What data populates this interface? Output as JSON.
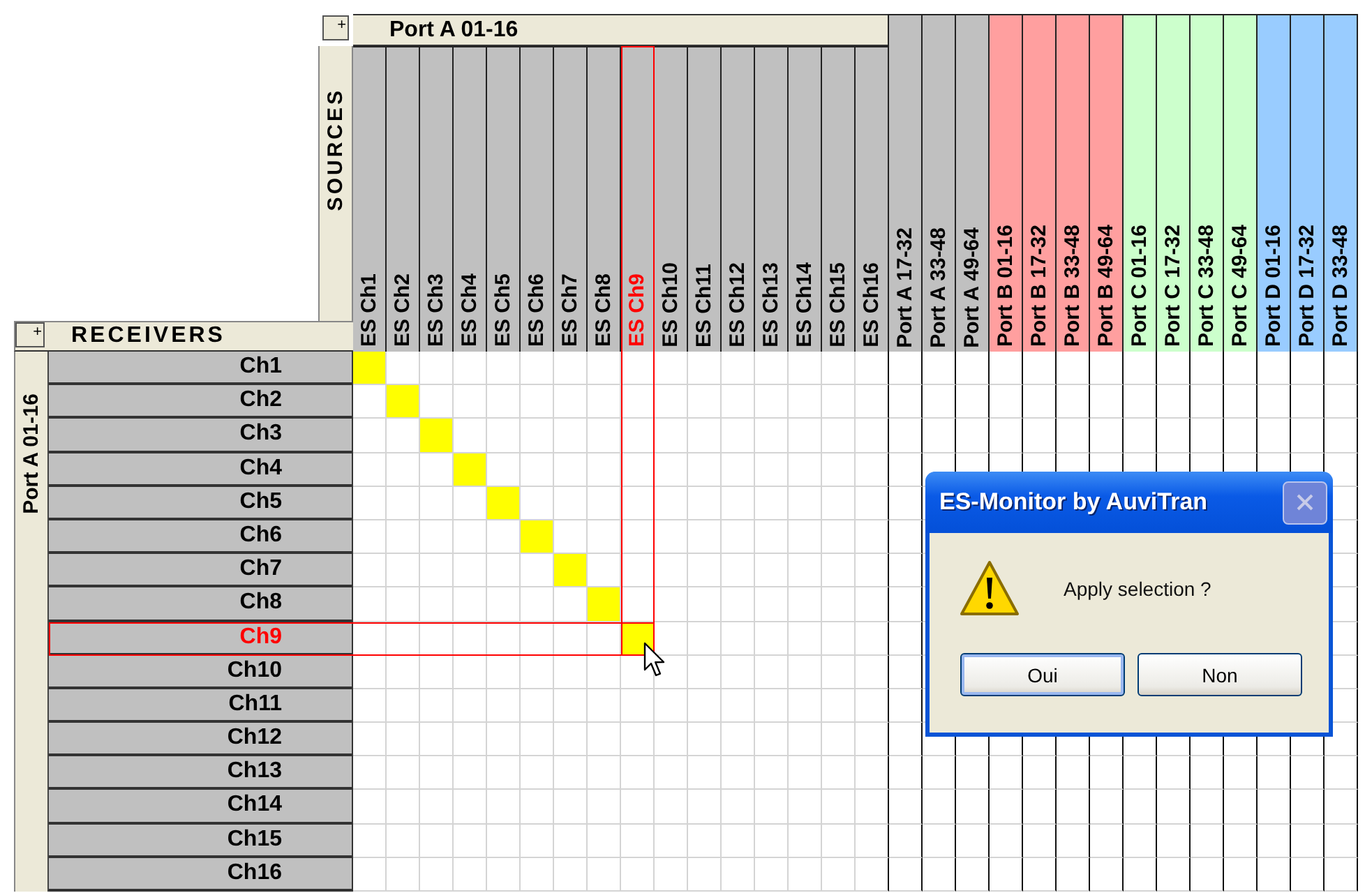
{
  "sources": {
    "expand": "+",
    "title": "SOURCES",
    "group_label": "Port A 01-16",
    "columns": [
      {
        "label": "ES Ch1",
        "kind": "channel",
        "color": "#c0c0c0",
        "selected": false
      },
      {
        "label": "ES Ch2",
        "kind": "channel",
        "color": "#c0c0c0",
        "selected": false
      },
      {
        "label": "ES Ch3",
        "kind": "channel",
        "color": "#c0c0c0",
        "selected": false
      },
      {
        "label": "ES Ch4",
        "kind": "channel",
        "color": "#c0c0c0",
        "selected": false
      },
      {
        "label": "ES Ch5",
        "kind": "channel",
        "color": "#c0c0c0",
        "selected": false
      },
      {
        "label": "ES Ch6",
        "kind": "channel",
        "color": "#c0c0c0",
        "selected": false
      },
      {
        "label": "ES Ch7",
        "kind": "channel",
        "color": "#c0c0c0",
        "selected": false
      },
      {
        "label": "ES Ch8",
        "kind": "channel",
        "color": "#c0c0c0",
        "selected": false
      },
      {
        "label": "ES Ch9",
        "kind": "channel",
        "color": "#c0c0c0",
        "selected": true
      },
      {
        "label": "ES Ch10",
        "kind": "channel",
        "color": "#c0c0c0",
        "selected": false
      },
      {
        "label": "ES Ch11",
        "kind": "channel",
        "color": "#c0c0c0",
        "selected": false
      },
      {
        "label": "ES Ch12",
        "kind": "channel",
        "color": "#c0c0c0",
        "selected": false
      },
      {
        "label": "ES Ch13",
        "kind": "channel",
        "color": "#c0c0c0",
        "selected": false
      },
      {
        "label": "ES Ch14",
        "kind": "channel",
        "color": "#c0c0c0",
        "selected": false
      },
      {
        "label": "ES Ch15",
        "kind": "channel",
        "color": "#c0c0c0",
        "selected": false
      },
      {
        "label": "ES Ch16",
        "kind": "channel",
        "color": "#c0c0c0",
        "selected": false
      },
      {
        "label": "Port A 17-32",
        "kind": "port",
        "color": "#c0c0c0",
        "selected": false
      },
      {
        "label": "Port A 33-48",
        "kind": "port",
        "color": "#c0c0c0",
        "selected": false
      },
      {
        "label": "Port A 49-64",
        "kind": "port",
        "color": "#c0c0c0",
        "selected": false
      },
      {
        "label": "Port B 01-16",
        "kind": "port",
        "color": "#ff9f9f",
        "selected": false
      },
      {
        "label": "Port B 17-32",
        "kind": "port",
        "color": "#ff9f9f",
        "selected": false
      },
      {
        "label": "Port B 33-48",
        "kind": "port",
        "color": "#ff9f9f",
        "selected": false
      },
      {
        "label": "Port B 49-64",
        "kind": "port",
        "color": "#ff9f9f",
        "selected": false
      },
      {
        "label": "Port C 01-16",
        "kind": "port",
        "color": "#ccffcc",
        "selected": false
      },
      {
        "label": "Port C 17-32",
        "kind": "port",
        "color": "#ccffcc",
        "selected": false
      },
      {
        "label": "Port C 33-48",
        "kind": "port",
        "color": "#ccffcc",
        "selected": false
      },
      {
        "label": "Port C 49-64",
        "kind": "port",
        "color": "#ccffcc",
        "selected": false
      },
      {
        "label": "Port D 01-16",
        "kind": "port",
        "color": "#99ccff",
        "selected": false
      },
      {
        "label": "Port D 17-32",
        "kind": "port",
        "color": "#99ccff",
        "selected": false
      },
      {
        "label": "Port D 33-48",
        "kind": "port",
        "color": "#99ccff",
        "selected": false
      }
    ]
  },
  "receivers": {
    "expand": "+",
    "title": "RECEIVERS",
    "group_label": "Port A 01-16",
    "rows": [
      {
        "label": "Ch1",
        "selected": false,
        "connections": [
          true,
          false,
          false,
          false,
          false,
          false,
          false,
          false,
          false,
          false,
          false,
          false,
          false,
          false,
          false,
          false
        ]
      },
      {
        "label": "Ch2",
        "selected": false,
        "connections": [
          false,
          true,
          false,
          false,
          false,
          false,
          false,
          false,
          false,
          false,
          false,
          false,
          false,
          false,
          false,
          false
        ]
      },
      {
        "label": "Ch3",
        "selected": false,
        "connections": [
          false,
          false,
          true,
          false,
          false,
          false,
          false,
          false,
          false,
          false,
          false,
          false,
          false,
          false,
          false,
          false
        ]
      },
      {
        "label": "Ch4",
        "selected": false,
        "connections": [
          false,
          false,
          false,
          true,
          false,
          false,
          false,
          false,
          false,
          false,
          false,
          false,
          false,
          false,
          false,
          false
        ]
      },
      {
        "label": "Ch5",
        "selected": false,
        "connections": [
          false,
          false,
          false,
          false,
          true,
          false,
          false,
          false,
          false,
          false,
          false,
          false,
          false,
          false,
          false,
          false
        ]
      },
      {
        "label": "Ch6",
        "selected": false,
        "connections": [
          false,
          false,
          false,
          false,
          false,
          true,
          false,
          false,
          false,
          false,
          false,
          false,
          false,
          false,
          false,
          false
        ]
      },
      {
        "label": "Ch7",
        "selected": false,
        "connections": [
          false,
          false,
          false,
          false,
          false,
          false,
          true,
          false,
          false,
          false,
          false,
          false,
          false,
          false,
          false,
          false
        ]
      },
      {
        "label": "Ch8",
        "selected": false,
        "connections": [
          false,
          false,
          false,
          false,
          false,
          false,
          false,
          true,
          false,
          false,
          false,
          false,
          false,
          false,
          false,
          false
        ]
      },
      {
        "label": "Ch9",
        "selected": true,
        "connections": [
          false,
          false,
          false,
          false,
          false,
          false,
          false,
          false,
          true,
          false,
          false,
          false,
          false,
          false,
          false,
          false
        ]
      },
      {
        "label": "Ch10",
        "selected": false,
        "connections": [
          false,
          false,
          false,
          false,
          false,
          false,
          false,
          false,
          false,
          false,
          false,
          false,
          false,
          false,
          false,
          false
        ]
      },
      {
        "label": "Ch11",
        "selected": false,
        "connections": [
          false,
          false,
          false,
          false,
          false,
          false,
          false,
          false,
          false,
          false,
          false,
          false,
          false,
          false,
          false,
          false
        ]
      },
      {
        "label": "Ch12",
        "selected": false,
        "connections": [
          false,
          false,
          false,
          false,
          false,
          false,
          false,
          false,
          false,
          false,
          false,
          false,
          false,
          false,
          false,
          false
        ]
      },
      {
        "label": "Ch13",
        "selected": false,
        "connections": [
          false,
          false,
          false,
          false,
          false,
          false,
          false,
          false,
          false,
          false,
          false,
          false,
          false,
          false,
          false,
          false
        ]
      },
      {
        "label": "Ch14",
        "selected": false,
        "connections": [
          false,
          false,
          false,
          false,
          false,
          false,
          false,
          false,
          false,
          false,
          false,
          false,
          false,
          false,
          false,
          false
        ]
      },
      {
        "label": "Ch15",
        "selected": false,
        "connections": [
          false,
          false,
          false,
          false,
          false,
          false,
          false,
          false,
          false,
          false,
          false,
          false,
          false,
          false,
          false,
          false
        ]
      },
      {
        "label": "Ch16",
        "selected": false,
        "connections": [
          false,
          false,
          false,
          false,
          false,
          false,
          false,
          false,
          false,
          false,
          false,
          false,
          false,
          false,
          false,
          false
        ]
      }
    ]
  },
  "dialog": {
    "title": "ES-Monitor by AuviTran",
    "message": "Apply selection ?",
    "buttons": [
      "Oui",
      "Non"
    ]
  }
}
